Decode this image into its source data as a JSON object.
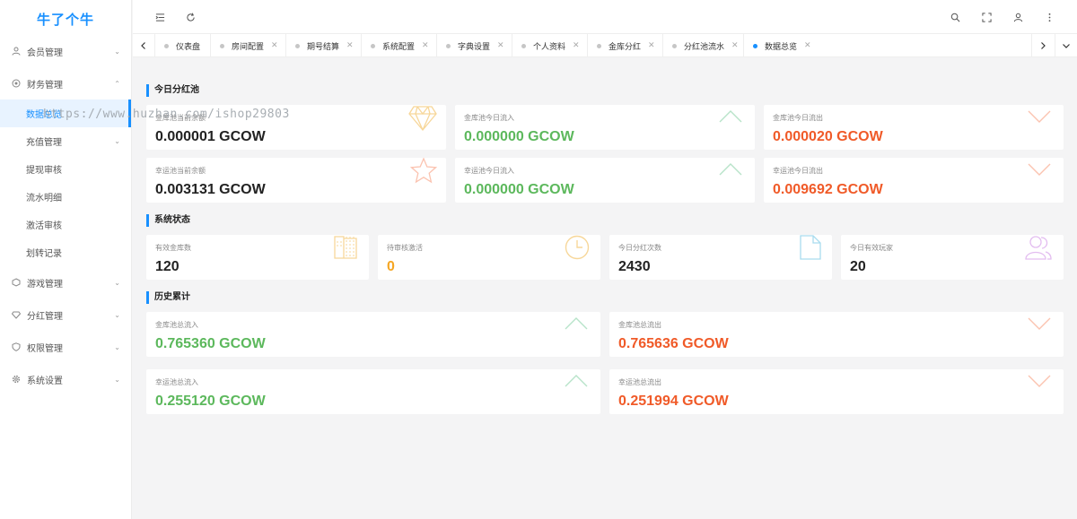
{
  "app": {
    "logo": "牛了个牛"
  },
  "sidebar": {
    "items": [
      {
        "label": "会员管理",
        "icon": "user-icon"
      },
      {
        "label": "财务管理",
        "icon": "finance-icon"
      },
      {
        "label": "游戏管理",
        "icon": "game-icon"
      },
      {
        "label": "分红管理",
        "icon": "dividend-icon"
      },
      {
        "label": "权限管理",
        "icon": "shield-icon"
      },
      {
        "label": "系统设置",
        "icon": "gear-icon"
      }
    ],
    "finance_sub": [
      {
        "label": "数据总览"
      },
      {
        "label": "充值管理"
      },
      {
        "label": "提现审核"
      },
      {
        "label": "流水明细"
      },
      {
        "label": "激活审核"
      },
      {
        "label": "划转记录"
      }
    ]
  },
  "tabs": [
    {
      "label": "仪表盘"
    },
    {
      "label": "房间配置"
    },
    {
      "label": "期号结算"
    },
    {
      "label": "系统配置"
    },
    {
      "label": "字典设置"
    },
    {
      "label": "个人资料"
    },
    {
      "label": "金库分红"
    },
    {
      "label": "分红池流水"
    },
    {
      "label": "数据总览"
    }
  ],
  "sections": {
    "today": "今日分红池",
    "system": "系统状态",
    "history": "历史累计"
  },
  "today_cards": [
    {
      "label": "金库池当前余额",
      "value": "0.000001 GCOW"
    },
    {
      "label": "金库池今日流入",
      "value": "0.000000 GCOW"
    },
    {
      "label": "金库池今日流出",
      "value": "0.000020 GCOW"
    },
    {
      "label": "幸运池当前余额",
      "value": "0.003131 GCOW"
    },
    {
      "label": "幸运池今日流入",
      "value": "0.000000 GCOW"
    },
    {
      "label": "幸运池今日流出",
      "value": "0.009692 GCOW"
    }
  ],
  "system_cards": [
    {
      "label": "有效金库数",
      "value": "120"
    },
    {
      "label": "待审核激活",
      "value": "0"
    },
    {
      "label": "今日分红次数",
      "value": "2430"
    },
    {
      "label": "今日有效玩家",
      "value": "20"
    }
  ],
  "history_cards": [
    {
      "label": "金库池总流入",
      "value": "0.765360 GCOW"
    },
    {
      "label": "金库池总流出",
      "value": "0.765636 GCOW"
    },
    {
      "label": "幸运池总流入",
      "value": "0.255120 GCOW"
    },
    {
      "label": "幸运池总流出",
      "value": "0.251994 GCOW"
    }
  ],
  "watermark": "https://www.huzhan.com/ishop29803",
  "colors": {
    "accent": "#1890ff",
    "inflow": "#5cb85c",
    "outflow": "#f05a28",
    "pending": "#f5a623"
  }
}
